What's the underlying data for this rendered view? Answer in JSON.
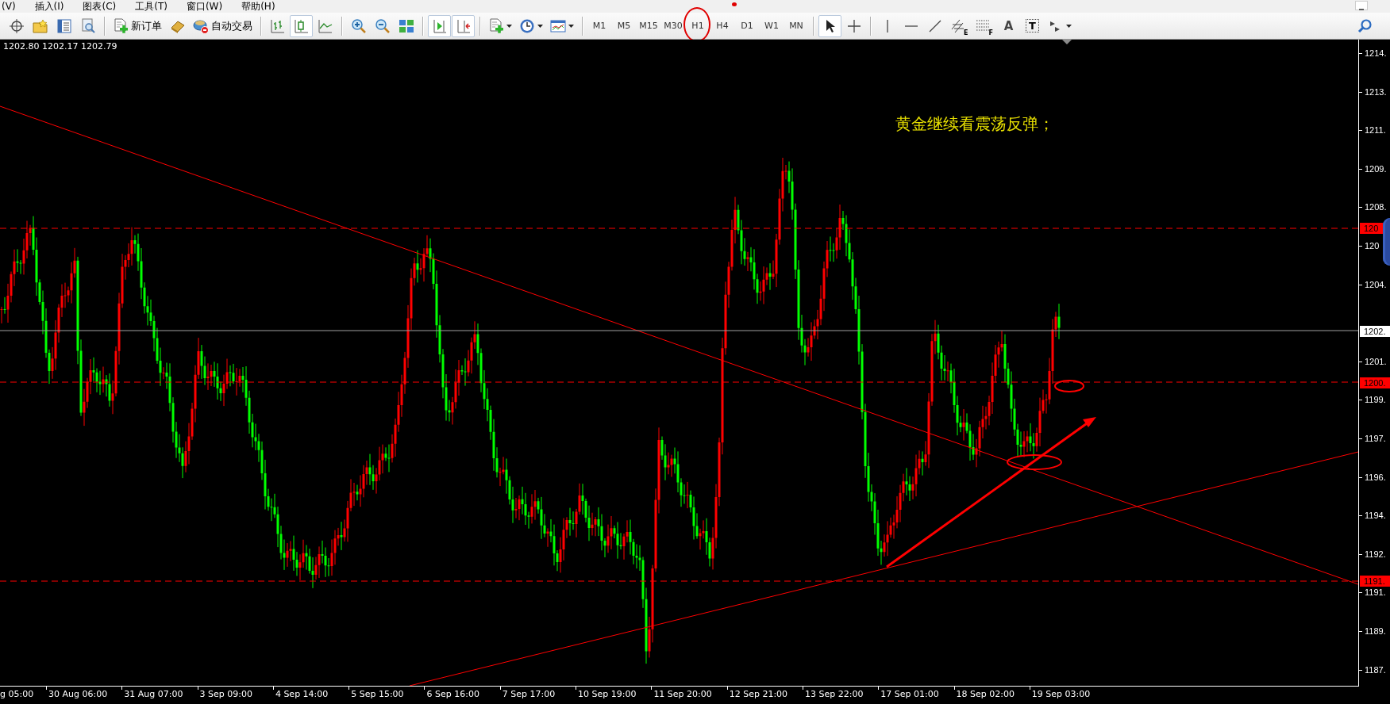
{
  "menu_bar": [
    "(V)",
    "插入(I)",
    "图表(C)",
    "工具(T)",
    "窗口(W)",
    "帮助(H)"
  ],
  "toolbar": {
    "new_order": "新订单",
    "auto_trading": "自动交易",
    "chart_types": [
      {
        "selected": false
      },
      {
        "selected": true
      },
      {
        "selected": false
      }
    ],
    "scroll_toggles": [
      {
        "on": true
      },
      {
        "on": true
      }
    ],
    "cursor_modes": [
      {
        "selected": true
      },
      {
        "selected": false
      }
    ],
    "timeframes": [
      {
        "label": "M1",
        "circled": false
      },
      {
        "label": "M5",
        "circled": false
      },
      {
        "label": "M15",
        "circled": false
      },
      {
        "label": "M30",
        "circled": false
      },
      {
        "label": "H1",
        "circled": true
      },
      {
        "label": "H4",
        "circled": false
      },
      {
        "label": "D1",
        "circled": false
      },
      {
        "label": "W1",
        "circled": false
      },
      {
        "label": "MN",
        "circled": false
      }
    ],
    "objects": [
      {
        "kind": "channel",
        "label": "E"
      },
      {
        "kind": "fibonacci",
        "label": "F"
      },
      {
        "kind": "text",
        "label": "A"
      },
      {
        "kind": "label",
        "label": "T"
      }
    ]
  },
  "chart": {
    "ohlc": "1202.80 1202.17 1202.79",
    "note": "黄金继续看震荡反弹；",
    "price_axis": [
      "1214.",
      "1213.",
      "1211.",
      "1209.",
      "1208.",
      "120",
      "1204.",
      "1201.",
      "1199.",
      "1197.",
      "1196.",
      "1194.",
      "1192.",
      "1191.",
      "1189.",
      "1187."
    ],
    "price_markers": [
      {
        "label": "120",
        "kind": "level"
      },
      {
        "label": "1202.",
        "kind": "bid"
      },
      {
        "label": "1200.",
        "kind": "level"
      },
      {
        "label": "1191.",
        "kind": "level"
      }
    ],
    "time_axis": [
      "g 05:00",
      "30 Aug 06:00",
      "31 Aug 07:00",
      "3 Sep 09:00",
      "4 Sep 14:00",
      "5 Sep 15:00",
      "6 Sep 16:00",
      "7 Sep 17:00",
      "10 Sep 19:00",
      "11 Sep 20:00",
      "12 Sep 21:00",
      "13 Sep 22:00",
      "17 Sep 01:00",
      "18 Sep 02:00",
      "19 Sep 03:00"
    ]
  }
}
